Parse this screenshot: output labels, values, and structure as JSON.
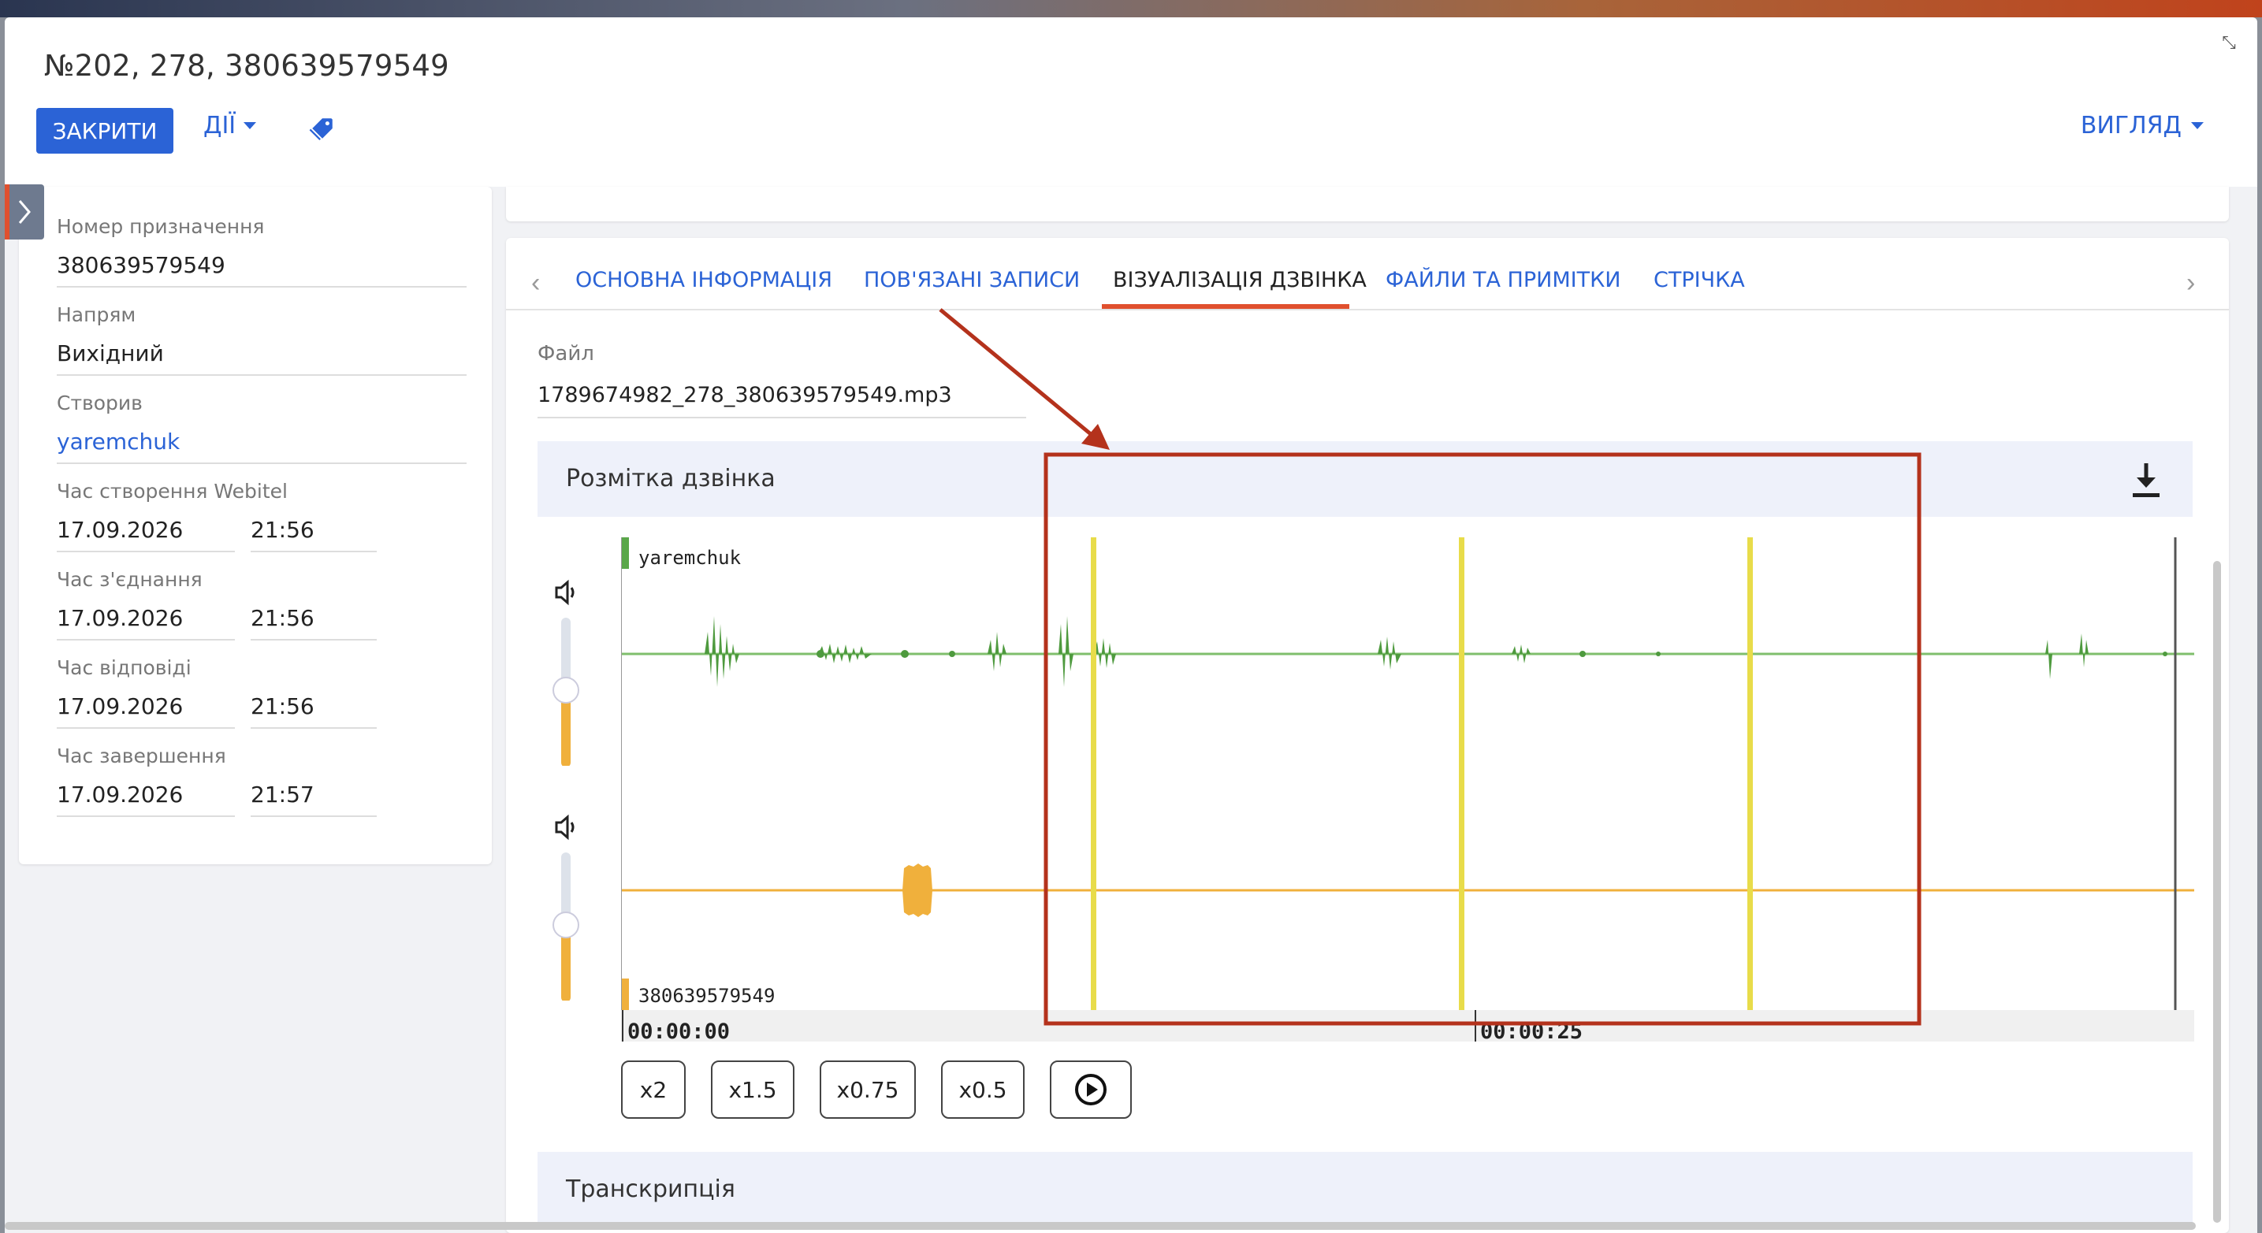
{
  "window": {
    "title": "№202, 278, 380639579549"
  },
  "toolbar": {
    "close_label": "ЗАКРИТИ",
    "actions_label": "ДІЇ",
    "view_label": "ВИГЛЯД"
  },
  "details": {
    "destination_label": "Номер призначення",
    "destination_value": "380639579549",
    "direction_label": "Напрям",
    "direction_value": "Вихідний",
    "created_by_label": "Створив",
    "created_by_value": "yaremchuk",
    "created_time_label": "Час створення Webitel",
    "created_date": "17.09.2026",
    "created_time": "21:56",
    "connected_label": "Час з'єднання",
    "connected_date": "17.09.2026",
    "connected_time": "21:56",
    "answered_label": "Час відповіді",
    "answered_date": "17.09.2026",
    "answered_time": "21:56",
    "ended_label": "Час завершення",
    "ended_date": "17.09.2026",
    "ended_time": "21:57"
  },
  "tabs": [
    {
      "label": "ОСНОВНА ІНФОРМАЦІЯ"
    },
    {
      "label": "ПОВ'ЯЗАНІ ЗАПИСИ"
    },
    {
      "label": "ВІЗУАЛІЗАЦІЯ ДЗВІНКА"
    },
    {
      "label": "ФАЙЛИ ТА ПРИМІТКИ"
    },
    {
      "label": "СТРІЧКА"
    }
  ],
  "active_tab": "ВІЗУАЛІЗАЦІЯ ДЗВІНКА",
  "file": {
    "label": "Файл",
    "value": "1789674982_278_380639579549.mp3"
  },
  "markup": {
    "title": "Розмітка дзвінка",
    "track1_label": "yaremchuk",
    "track2_label": "380639579549",
    "time_start": "00:00:00",
    "time_mid": "00:00:25",
    "track1_color": "#5aa74a",
    "track2_color": "#f0b03c",
    "marker_color": "#e8dc4a",
    "highlight_color": "#b4321c"
  },
  "speed_buttons": [
    "x2",
    "x1.5",
    "x0.75",
    "x0.5"
  ],
  "play_icon": "play-circle-icon",
  "transcription": {
    "title": "Транскрипція"
  }
}
